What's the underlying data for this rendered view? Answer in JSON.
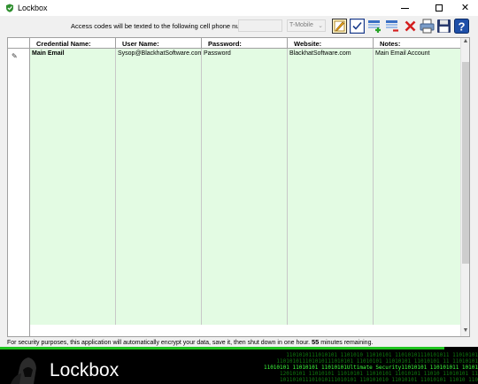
{
  "window": {
    "title": "Lockbox",
    "minimize_icon": "minimize-icon",
    "maximize_icon": "maximize-icon",
    "close_glyph": "✕"
  },
  "toolbar": {
    "access_label": "Access codes will be texted to the following cell phone number:",
    "phone_value": "",
    "carrier": "T-Mobile",
    "buttons": [
      "edit-icon",
      "checkbox-icon",
      "add-row-icon",
      "remove-row-icon",
      "delete-icon",
      "print-icon",
      "save-icon",
      "help-icon"
    ],
    "help_glyph": "?"
  },
  "grid": {
    "columns": [
      "Credential Name:",
      "User Name:",
      "Password:",
      "Website:",
      "Notes:"
    ],
    "rows": [
      {
        "credential": "Main Email",
        "user": "Sysop@BlackhatSoftware.com",
        "password": "Password",
        "website": "BlackhatSoftware.com",
        "notes": "Main Email Account"
      }
    ],
    "empty_row_count": 25,
    "row_pointer_glyph": "✎",
    "scroll_up_glyph": "▲",
    "scroll_down_glyph": "▼"
  },
  "status": {
    "text_before": "For security purposes, this application will automatically encrypt your data, save it, then shut down in one hour.",
    "minutes": "55",
    "text_after": "minutes remaining."
  },
  "banner": {
    "title": "Lockbox",
    "code_lines": [
      "1101010111010101 1101010 11010101 11010101110101011 11010101",
      "110101011101010111010101 11010101 11010101 11010101 11 11010101",
      "11010101 11010101 11010101Ultimate Security11010101 110101011 10101",
      "12010101 11010101 11010101 11010101 11010101 11010 11010101 11",
      "101101011101010111010101 110101010 11010101 11010101 11010 110"
    ]
  }
}
